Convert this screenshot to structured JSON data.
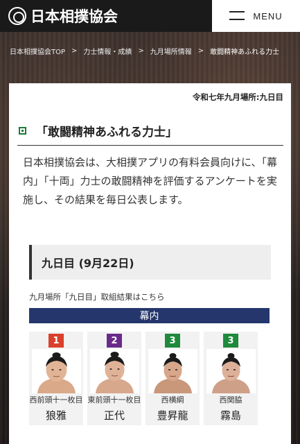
{
  "header": {
    "logo_text": "日本相撲協会",
    "menu_label": "MENU"
  },
  "breadcrumb": [
    {
      "label": "日本相撲協会TOP"
    },
    {
      "label": "力士情報・成績"
    },
    {
      "label": "九月場所情報"
    },
    {
      "label": "敢闘精神あふれる力士"
    }
  ],
  "breadcrumb_separator": ">",
  "page": {
    "basho_day": "令和七年九月場所:九日目",
    "title": "「敢闘精神あふれる力士」",
    "intro": "日本相撲協会は、大相撲アプリの有料会員向けに、「幕内」「十両」力士の敢闘精神を評価するアンケートを実施し、その結果を毎日公表します。",
    "day_heading": "九日目 (9月22日)",
    "results_link": "九月場所「九日目」取組結果はこちら",
    "division": "幕内"
  },
  "rikishi": [
    {
      "rank": "1",
      "badge_color": "#d9412b",
      "title": "西前頭十一枚目",
      "name": "狼雅"
    },
    {
      "rank": "2",
      "badge_color": "#6a2a8c",
      "title": "東前頭十一枚目",
      "name": "正代"
    },
    {
      "rank": "3",
      "badge_color": "#1f8a3c",
      "title": "西横綱",
      "name": "豊昇龍"
    },
    {
      "rank": "3",
      "badge_color": "#1f8a3c",
      "title": "西関脇",
      "name": "霧島"
    }
  ]
}
